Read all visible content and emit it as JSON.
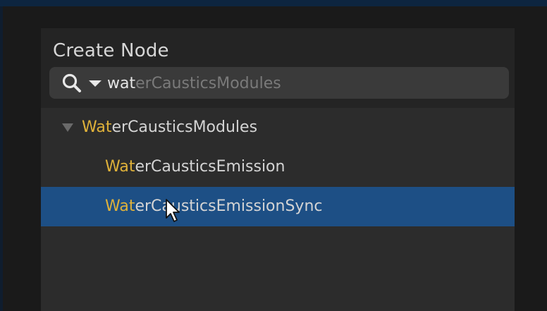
{
  "dialog": {
    "title": "Create Node"
  },
  "search": {
    "typed": "wat",
    "suggestion": "erCausticsModules",
    "icon": "search-icon",
    "options_icon": "chevron-down-icon"
  },
  "results": {
    "items": [
      {
        "highlight": "Wat",
        "rest": "erCausticsModules",
        "expanded": true,
        "selected": false
      },
      {
        "highlight": "Wat",
        "rest": "erCausticsEmission",
        "selected": false
      },
      {
        "highlight": "Wat",
        "rest": "erCausticsEmissionSync",
        "selected": true
      }
    ]
  },
  "colors": {
    "highlight": "#e0b23a",
    "selection": "#1d4f85",
    "panel": "#242424"
  }
}
